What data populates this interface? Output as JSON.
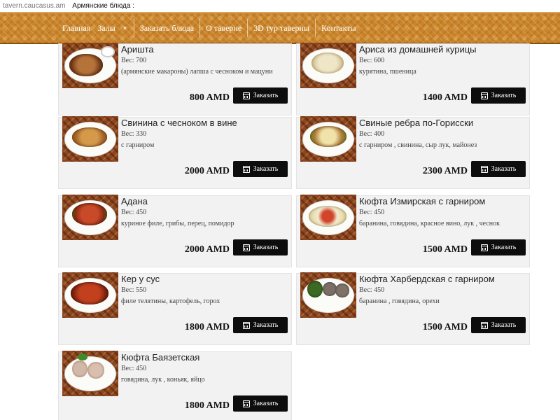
{
  "browser": {
    "site": "tavern.caucasus.am",
    "page_title": "Армянские блюда :"
  },
  "nav": [
    {
      "label": "Главная"
    },
    {
      "label": "Залы",
      "has_dropdown": true
    },
    {
      "label": "Заказать блюда"
    },
    {
      "label": "О таверне"
    },
    {
      "label": "3D тур таверны"
    },
    {
      "label": "Контакты"
    }
  ],
  "dishes": [
    {
      "title": "Аришта",
      "weight": "Вес: 700",
      "desc": "(армянские макароны) лапша с чесноком и мацуни",
      "price": "800 AMD",
      "order_label": "Заказать"
    },
    {
      "title": "Ариса из домашней курицы",
      "weight": "Вес: 600",
      "desc": "курятина, пшеница",
      "price": "1400 AMD",
      "order_label": "Заказать"
    },
    {
      "title": "Свинина с чесноком в вине",
      "weight": "Вес: 330",
      "desc": "с гарниром",
      "price": "2000 AMD",
      "order_label": "Заказать"
    },
    {
      "title": "Свиные ребра по-Горисски",
      "weight": "Вес: 400",
      "desc": "с гарниром , свинина, сыр лук, майонез",
      "price": "2300 AMD",
      "order_label": "Заказать"
    },
    {
      "title": "Адана",
      "weight": "Вес: 450",
      "desc": "куриное филе, грибы, перец, помидор",
      "price": "2000 AMD",
      "order_label": "Заказать"
    },
    {
      "title": "Кюфта Измирская с гарниром",
      "weight": "Вес: 450",
      "desc": "баранина, говядина, красное вино, лук , чеснок",
      "price": "1500 AMD",
      "order_label": "Заказать"
    },
    {
      "title": "Кер у сус",
      "weight": "Вес: 550",
      "desc": "филе телятины, картофель, горох",
      "price": "1800 AMD",
      "order_label": "Заказать"
    },
    {
      "title": "Кюфта Харбердская с гарниром",
      "weight": "Вес: 450",
      "desc": "баранина , говядина, орехи",
      "price": "1500 AMD",
      "order_label": "Заказать"
    },
    {
      "title": "Кюфта Баязетская",
      "weight": "Вес: 450",
      "desc": "говядина, лук , коньяк, яйцо",
      "price": "1800 AMD",
      "order_label": "Заказать"
    }
  ],
  "colors": {
    "nav_bg": "#c9832a",
    "card_bg": "#f2f2f2",
    "button_bg": "#0d0d0d"
  }
}
